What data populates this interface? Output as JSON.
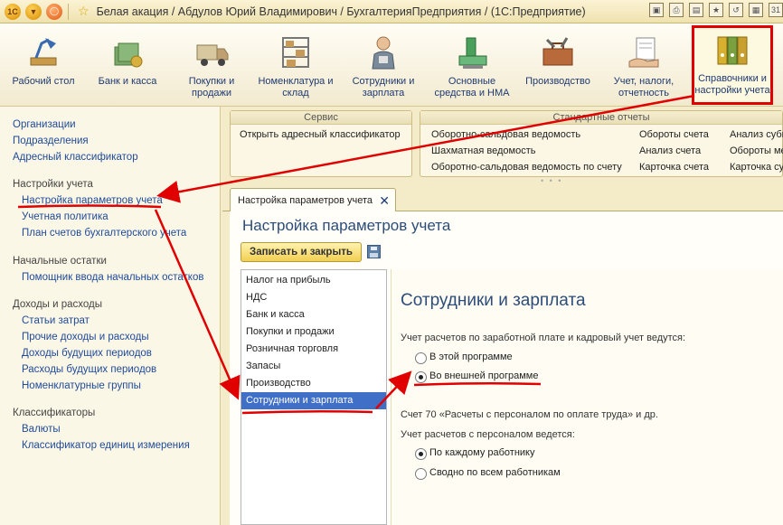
{
  "window": {
    "title": "Белая акация / Абдулов Юрий Владимирович / БухгалтерияПредприятия / (1С:Предприятие)",
    "logo": "1С"
  },
  "sections": [
    {
      "label": "Рабочий стол",
      "icon": "desk-lamp-icon"
    },
    {
      "label": "Банк и касса",
      "icon": "money-icon"
    },
    {
      "label": "Покупки и продажи",
      "icon": "truck-icon"
    },
    {
      "label": "Номенклатура и склад",
      "icon": "shelf-icon"
    },
    {
      "label": "Сотрудники и зарплата",
      "icon": "worker-icon"
    },
    {
      "label": "Основные средства и НМА",
      "icon": "machine-icon"
    },
    {
      "label": "Производство",
      "icon": "toolbox-icon"
    },
    {
      "label": "Учет, налоги, отчетность",
      "icon": "hand-paper-icon"
    },
    {
      "label": "Справочники и настройки учета",
      "icon": "binders-icon"
    }
  ],
  "left": {
    "top_links": [
      "Организации",
      "Подразделения",
      "Адресный классификатор"
    ],
    "groups": [
      {
        "title": "Настройки учета",
        "items": [
          "Настройка параметров учета",
          "Учетная политика",
          "План счетов бухгалтерского учета"
        ]
      },
      {
        "title": "Начальные остатки",
        "items": [
          "Помощник ввода начальных остатков"
        ]
      },
      {
        "title": "Доходы и расходы",
        "items": [
          "Статьи затрат",
          "Прочие доходы и расходы",
          "Доходы будущих периодов",
          "Расходы будущих периодов",
          "Номенклатурные группы"
        ]
      },
      {
        "title": "Классификаторы",
        "items": [
          "Валюты",
          "Классификатор единиц измерения"
        ]
      }
    ]
  },
  "commands": {
    "service_title": "Сервис",
    "service_links": [
      "Открыть адресный классификатор"
    ],
    "reports_title": "Стандартные отчеты",
    "reports_col1": [
      "Оборотно-сальдовая ведомость",
      "Шахматная ведомость",
      "Оборотно-сальдовая ведомость по счету"
    ],
    "reports_col2": [
      "Обороты счета",
      "Анализ счета",
      "Карточка счета"
    ],
    "reports_col3": [
      "Анализ субконто",
      "Обороты меж",
      "Карточка субко"
    ]
  },
  "tab": {
    "label": "Настройка параметров учета"
  },
  "form": {
    "title": "Настройка параметров учета",
    "save_label": "Записать и закрыть",
    "list": [
      "Налог на прибыль",
      "НДС",
      "Банк и касса",
      "Покупки и продажи",
      "Розничная торговля",
      "Запасы",
      "Производство",
      "Сотрудники и зарплата"
    ],
    "selected_index": 7,
    "panel": {
      "title": "Сотрудники и зарплата",
      "q1": "Учет расчетов по заработной плате и кадровый учет ведутся:",
      "q1_opt1": "В этой программе",
      "q1_opt2": "Во внешней программе",
      "q1_selected": 2,
      "note": "Счет 70 «Расчеты с персоналом по оплате труда» и др.",
      "q2": "Учет расчетов с персоналом ведется:",
      "q2_opt1": "По каждому работнику",
      "q2_opt2": "Сводно по всем работникам",
      "q2_selected": 1
    }
  },
  "colors": {
    "annotation": "#e00000",
    "selection": "#3f6fc6",
    "link": "#1f4a9a"
  }
}
